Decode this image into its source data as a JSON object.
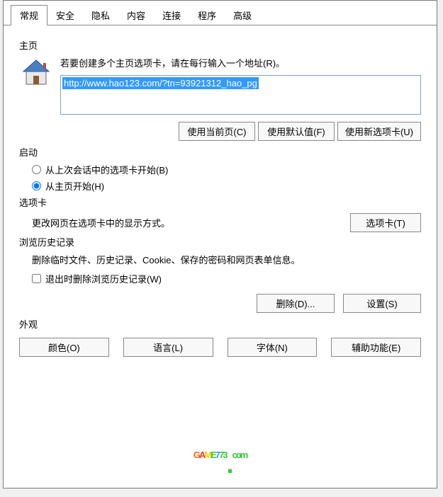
{
  "tabs": {
    "general": "常规",
    "security": "安全",
    "privacy": "隐私",
    "content": "内容",
    "connections": "连接",
    "programs": "程序",
    "advanced": "高级"
  },
  "homepage": {
    "label": "主页",
    "instruction": "若要创建多个主页选项卡，请在每行输入一个地址(R)。",
    "url": "http://www.hao123.com/?tn=93921312_hao_pg",
    "use_current": "使用当前页(C)",
    "use_default": "使用默认值(F)",
    "use_new_tab": "使用新选项卡(U)"
  },
  "startup": {
    "label": "启动",
    "from_last_session": "从上次会话中的选项卡开始(B)",
    "from_homepage": "从主页开始(H)"
  },
  "tabs_section": {
    "label": "选项卡",
    "description": "更改网页在选项卡中的显示方式。",
    "button": "选项卡(T)"
  },
  "history": {
    "label": "浏览历史记录",
    "description": "删除临时文件、历史记录、Cookie、保存的密码和网页表单信息。",
    "delete_on_exit": "退出时删除浏览历史记录(W)",
    "delete_button": "删除(D)...",
    "settings_button": "设置(S)"
  },
  "appearance": {
    "label": "外观",
    "colors": "颜色(O)",
    "languages": "语言(L)",
    "fonts": "字体(N)",
    "accessibility": "辅助功能(E)"
  },
  "watermark": "GAME773.com"
}
